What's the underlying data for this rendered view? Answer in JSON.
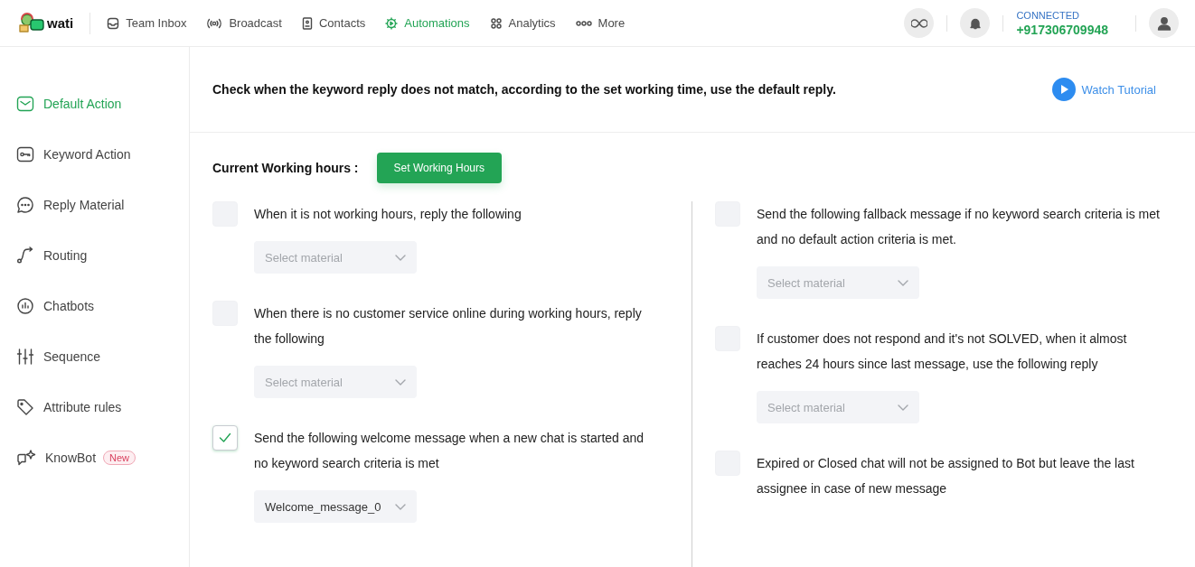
{
  "header": {
    "logo_text": "wati",
    "tabs": [
      {
        "label": "Team Inbox",
        "selected": false
      },
      {
        "label": "Broadcast",
        "selected": false
      },
      {
        "label": "Contacts",
        "selected": false
      },
      {
        "label": "Automations",
        "selected": true
      },
      {
        "label": "Analytics",
        "selected": false
      },
      {
        "label": "More",
        "selected": false
      }
    ],
    "connection": {
      "status": "CONNECTED",
      "phone": "+917306709948"
    }
  },
  "sidebar": {
    "items": [
      {
        "label": "Default Action",
        "selected": true
      },
      {
        "label": "Keyword Action",
        "selected": false
      },
      {
        "label": "Reply Material",
        "selected": false
      },
      {
        "label": "Routing",
        "selected": false
      },
      {
        "label": "Chatbots",
        "selected": false
      },
      {
        "label": "Sequence",
        "selected": false
      },
      {
        "label": "Attribute rules",
        "selected": false
      },
      {
        "label": "KnowBot",
        "selected": false,
        "badge": "New"
      }
    ]
  },
  "main": {
    "description": "Check when the keyword reply does not match, according to the set working time, use the default reply.",
    "tutorial_link": "Watch Tutorial",
    "working_hours_label": "Current Working hours :",
    "working_hours_button": "Set Working Hours",
    "left_options": [
      {
        "text": "When it is not working hours, reply the following",
        "checked": false,
        "dropdown": {
          "placeholder": "Select material"
        }
      },
      {
        "text": "When there is no customer service online during working hours, reply the following",
        "checked": false,
        "dropdown": {
          "placeholder": "Select material"
        }
      },
      {
        "text": "Send the following welcome message when a new chat is started and no keyword search criteria is met",
        "checked": true,
        "dropdown": {
          "value": "Welcome_message_0"
        }
      }
    ],
    "right_options": [
      {
        "text": "Send the following fallback message if no keyword search criteria is met and no default action criteria is met.",
        "checked": false,
        "dropdown": {
          "placeholder": "Select material"
        }
      },
      {
        "text": "If customer does not respond and it's not SOLVED, when it almost reaches 24 hours since last message, use the following reply",
        "checked": false,
        "dropdown": {
          "placeholder": "Select material"
        }
      },
      {
        "text": "Expired or Closed chat will not be assigned to Bot but leave the last assignee in case of new message",
        "checked": false
      }
    ]
  }
}
